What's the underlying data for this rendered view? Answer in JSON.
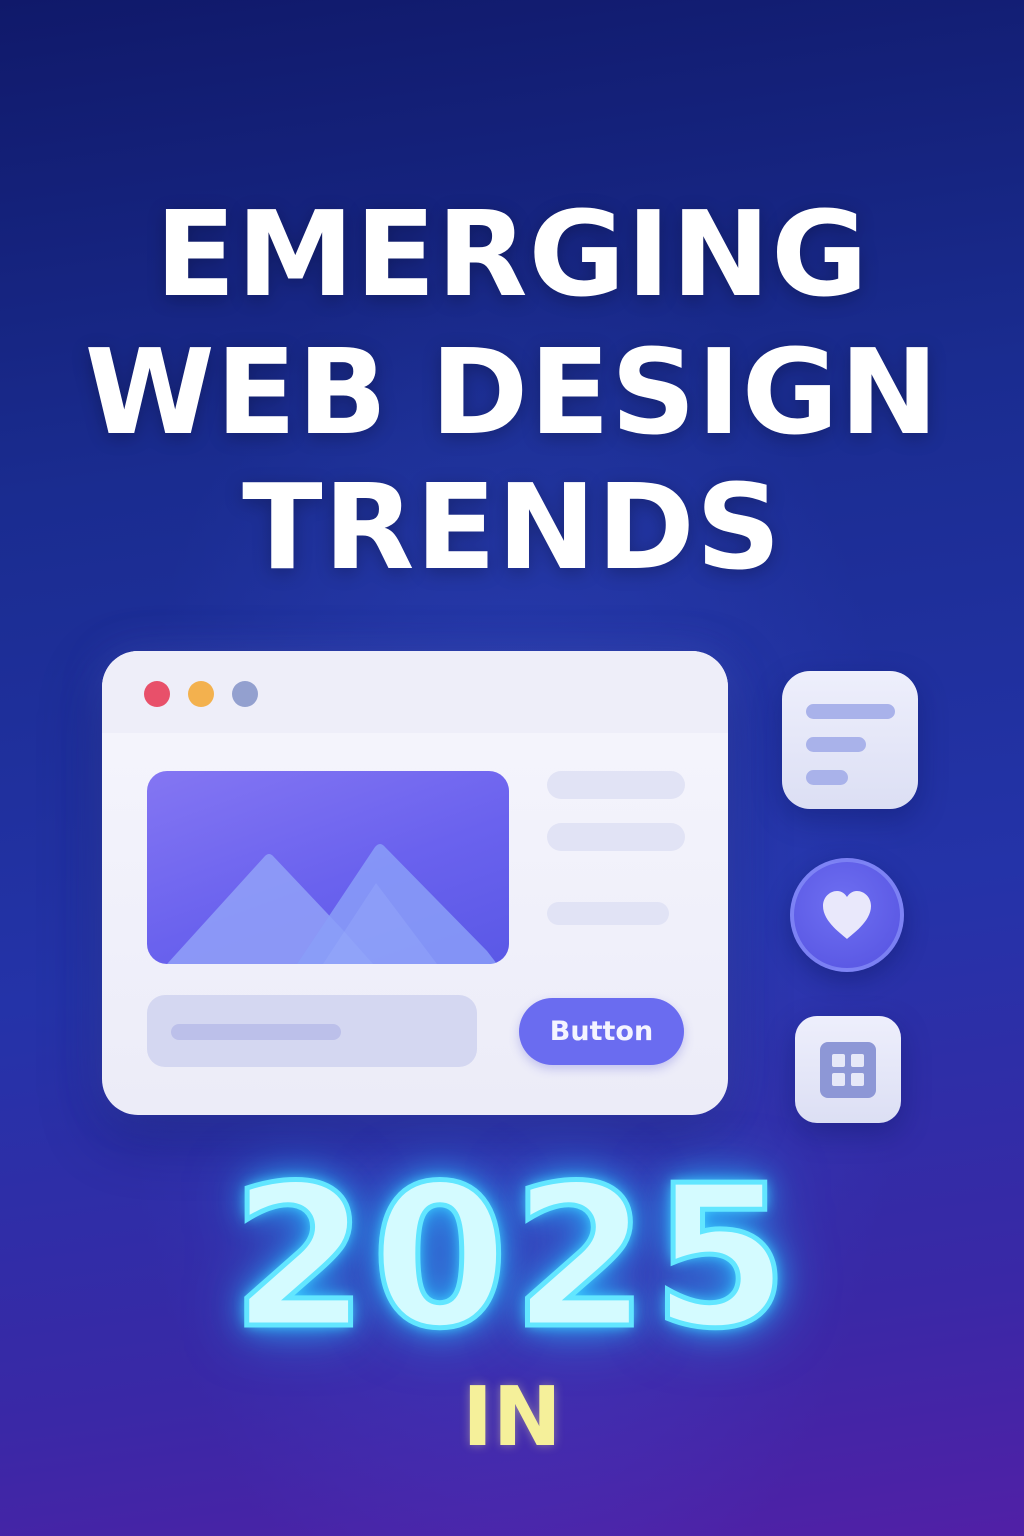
{
  "headline": {
    "line1": "EMERGING",
    "line2": "WEB DESIGN",
    "line3": "TRENDS"
  },
  "mockup": {
    "window_dots": [
      "red",
      "yellow",
      "blue"
    ],
    "hero_icon": "mountain-image-icon",
    "button_label": "Button"
  },
  "side_icons": [
    "text-lines-icon",
    "heart-icon",
    "grid-icon"
  ],
  "year": "2025",
  "suffix": "IN",
  "colors": {
    "background_top": "#10196a",
    "background_bottom": "#5120a6",
    "accent_purple": "#6a6cf0",
    "neon_cyan": "#62e6ff",
    "suffix_yellow": "#f5f09a"
  }
}
